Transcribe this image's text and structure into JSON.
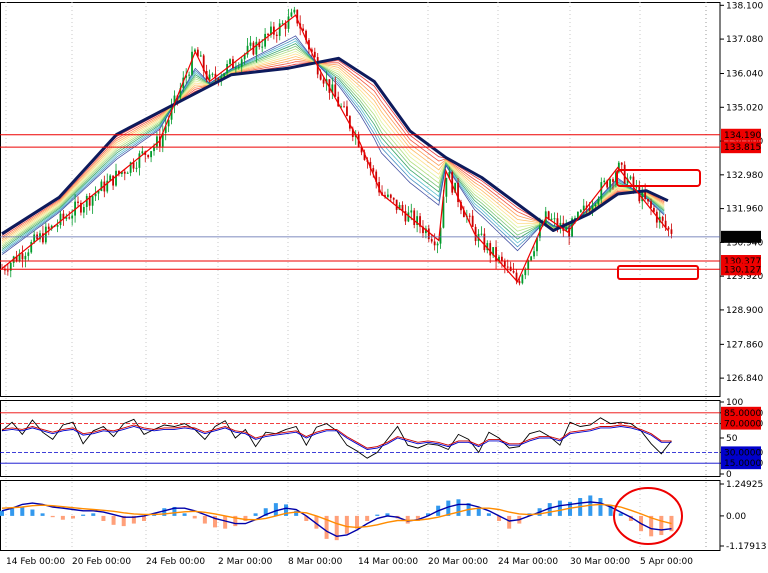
{
  "chart_data": [
    {
      "type": "candlestick",
      "panel": "price",
      "yticks": [
        "138.100",
        "137.080",
        "136.040",
        "135.020",
        "134.000",
        "132.980",
        "131.960",
        "130.940",
        "129.920",
        "128.900",
        "127.860",
        "126.840"
      ],
      "ylim": [
        126.3,
        138.2
      ],
      "xticks": [
        "14 Feb 00:00",
        "20 Feb 00:00",
        "24 Feb 00:00",
        "2 Mar 00:00",
        "8 Mar 00:00",
        "14 Mar 00:00",
        "20 Mar 00:00",
        "24 Mar 00:00",
        "30 Mar 00:00",
        "5 Apr 00:00"
      ],
      "hlines": [
        {
          "label": "134.190",
          "value": 134.19,
          "color": "#ee0000"
        },
        {
          "label": "133.815",
          "value": 133.815,
          "color": "#ee0000"
        },
        {
          "label": "130.377",
          "value": 130.377,
          "color": "#ee0000"
        },
        {
          "label": "130.127",
          "value": 130.127,
          "color": "#ee0000"
        }
      ],
      "current_price": {
        "label": "131.107",
        "value": 131.107,
        "color": "#000000"
      },
      "zigzag": [
        {
          "x": 0.0,
          "y": 130.15
        },
        {
          "x": 0.22,
          "y": 134.0
        },
        {
          "x": 0.27,
          "y": 136.7
        },
        {
          "x": 0.29,
          "y": 135.8
        },
        {
          "x": 0.41,
          "y": 137.8
        },
        {
          "x": 0.44,
          "y": 136.3
        },
        {
          "x": 0.5,
          "y": 133.95
        },
        {
          "x": 0.53,
          "y": 132.4
        },
        {
          "x": 0.61,
          "y": 131.0
        },
        {
          "x": 0.62,
          "y": 133.1
        },
        {
          "x": 0.66,
          "y": 131.2
        },
        {
          "x": 0.72,
          "y": 129.75
        },
        {
          "x": 0.76,
          "y": 131.7
        },
        {
          "x": 0.79,
          "y": 131.25
        },
        {
          "x": 0.86,
          "y": 133.2
        },
        {
          "x": 0.93,
          "y": 131.3
        }
      ],
      "ma_main": [
        {
          "x": 0.0,
          "y": 131.2
        },
        {
          "x": 0.08,
          "y": 132.3
        },
        {
          "x": 0.16,
          "y": 134.2
        },
        {
          "x": 0.24,
          "y": 135.1
        },
        {
          "x": 0.32,
          "y": 136.0
        },
        {
          "x": 0.4,
          "y": 136.2
        },
        {
          "x": 0.47,
          "y": 136.5
        },
        {
          "x": 0.52,
          "y": 135.8
        },
        {
          "x": 0.57,
          "y": 134.3
        },
        {
          "x": 0.62,
          "y": 133.5
        },
        {
          "x": 0.67,
          "y": 132.9
        },
        {
          "x": 0.72,
          "y": 132.1
        },
        {
          "x": 0.77,
          "y": 131.3
        },
        {
          "x": 0.82,
          "y": 131.8
        },
        {
          "x": 0.86,
          "y": 132.4
        },
        {
          "x": 0.9,
          "y": 132.5
        },
        {
          "x": 0.93,
          "y": 132.2
        }
      ]
    },
    {
      "type": "line",
      "panel": "oscillator",
      "yticks": [
        "100",
        "85.0000",
        "70.0000",
        "50",
        "30.0000",
        "15.0000",
        "0"
      ],
      "ylim": [
        0,
        100
      ],
      "levels": [
        {
          "label": "85.0000",
          "value": 85,
          "color": "#ee0000"
        },
        {
          "label": "70.0000",
          "value": 70,
          "color": "#ee0000"
        },
        {
          "label": "30.0000",
          "value": 30,
          "color": "#0000cc"
        },
        {
          "label": "15.0000",
          "value": 15,
          "color": "#0000cc"
        }
      ],
      "series": [
        {
          "color": "#000000",
          "values": [
            60,
            72,
            55,
            75,
            58,
            48,
            68,
            72,
            42,
            60,
            66,
            52,
            70,
            76,
            55,
            62,
            68,
            66,
            70,
            62,
            48,
            66,
            74,
            50,
            62,
            38,
            58,
            56,
            62,
            66,
            40,
            65,
            70,
            60,
            40,
            32,
            22,
            30,
            48,
            66,
            40,
            36,
            42,
            40,
            34,
            55,
            48,
            30,
            58,
            50,
            36,
            38,
            56,
            60,
            52,
            40,
            72,
            66,
            68,
            78,
            70,
            72,
            70,
            60,
            42,
            28,
            46
          ]
        },
        {
          "color": "#cc0000",
          "values": [
            62,
            64,
            62,
            66,
            62,
            58,
            62,
            64,
            56,
            58,
            62,
            60,
            64,
            68,
            64,
            62,
            64,
            64,
            66,
            64,
            58,
            62,
            66,
            60,
            58,
            50,
            54,
            56,
            58,
            60,
            52,
            58,
            62,
            62,
            52,
            44,
            36,
            38,
            44,
            52,
            48,
            44,
            46,
            44,
            40,
            46,
            46,
            40,
            48,
            48,
            42,
            42,
            48,
            52,
            52,
            48,
            58,
            60,
            62,
            66,
            66,
            68,
            66,
            62,
            56,
            46,
            46
          ]
        },
        {
          "color": "#0000cc",
          "values": [
            60,
            62,
            60,
            64,
            60,
            56,
            60,
            62,
            54,
            56,
            60,
            58,
            62,
            66,
            62,
            60,
            62,
            62,
            64,
            62,
            56,
            60,
            64,
            58,
            56,
            48,
            52,
            54,
            56,
            58,
            50,
            56,
            60,
            60,
            50,
            42,
            34,
            36,
            42,
            50,
            46,
            42,
            44,
            42,
            38,
            44,
            44,
            38,
            46,
            46,
            40,
            40,
            46,
            50,
            50,
            46,
            56,
            58,
            60,
            64,
            64,
            66,
            64,
            60,
            54,
            44,
            44
          ]
        }
      ]
    },
    {
      "type": "bar",
      "panel": "macd",
      "yticks": [
        "1.24925",
        "0.00",
        "-1.17913"
      ],
      "ylim": [
        -1.17913,
        1.24925
      ],
      "bars": [
        0.2,
        0.3,
        0.35,
        0.25,
        0.1,
        -0.05,
        -0.15,
        -0.1,
        0.05,
        0.1,
        -0.2,
        -0.35,
        -0.4,
        -0.3,
        -0.2,
        0.1,
        0.3,
        0.35,
        0.1,
        -0.1,
        -0.3,
        -0.45,
        -0.5,
        -0.4,
        -0.2,
        0.1,
        0.3,
        0.5,
        0.45,
        0.2,
        -0.2,
        -0.5,
        -0.9,
        -0.95,
        -0.7,
        -0.5,
        -0.2,
        0.05,
        0.1,
        -0.1,
        -0.3,
        -0.2,
        0.1,
        0.4,
        0.6,
        0.65,
        0.5,
        0.3,
        0.1,
        -0.2,
        -0.5,
        -0.3,
        0.1,
        0.3,
        0.5,
        0.6,
        0.55,
        0.7,
        0.8,
        0.7,
        0.4,
        0.1,
        -0.2,
        -0.6,
        -0.8,
        -0.75,
        -0.6
      ],
      "macd_line": [
        0.2,
        0.3,
        0.45,
        0.5,
        0.45,
        0.35,
        0.3,
        0.25,
        0.2,
        0.2,
        0.15,
        0.05,
        -0.05,
        -0.05,
        0.0,
        0.1,
        0.2,
        0.3,
        0.3,
        0.2,
        0.05,
        -0.1,
        -0.2,
        -0.3,
        -0.3,
        -0.15,
        0.05,
        0.2,
        0.3,
        0.25,
        0.0,
        -0.3,
        -0.6,
        -0.8,
        -0.75,
        -0.55,
        -0.3,
        -0.1,
        0.0,
        -0.05,
        -0.2,
        -0.15,
        0.0,
        0.2,
        0.35,
        0.45,
        0.45,
        0.35,
        0.2,
        0.0,
        -0.2,
        -0.15,
        0.0,
        0.15,
        0.3,
        0.4,
        0.45,
        0.5,
        0.55,
        0.5,
        0.35,
        0.15,
        -0.05,
        -0.3,
        -0.5,
        -0.55,
        -0.5
      ],
      "signal_line": [
        0.3,
        0.32,
        0.35,
        0.4,
        0.42,
        0.4,
        0.36,
        0.32,
        0.28,
        0.25,
        0.22,
        0.18,
        0.12,
        0.08,
        0.06,
        0.06,
        0.08,
        0.12,
        0.16,
        0.18,
        0.14,
        0.08,
        0.0,
        -0.08,
        -0.14,
        -0.15,
        -0.1,
        0.0,
        0.1,
        0.15,
        0.12,
        0.0,
        -0.15,
        -0.3,
        -0.42,
        -0.45,
        -0.42,
        -0.35,
        -0.25,
        -0.18,
        -0.18,
        -0.17,
        -0.12,
        -0.05,
        0.05,
        0.15,
        0.25,
        0.3,
        0.3,
        0.25,
        0.15,
        0.08,
        0.05,
        0.08,
        0.15,
        0.22,
        0.3,
        0.36,
        0.42,
        0.45,
        0.42,
        0.35,
        0.22,
        0.08,
        -0.08,
        -0.2,
        -0.3
      ]
    }
  ],
  "colors": {
    "border": "#000000",
    "grid": "#c8c8c8",
    "bull": "#009a2a",
    "bear": "#cc0000",
    "ma_main": "#0d1a5c",
    "zigzag": "#ee0000",
    "hist_pos": "#3399ee",
    "hist_neg": "#ffa07a",
    "macd_line": "#0000aa",
    "signal_line": "#ff8c00",
    "annotation": "#ee0000"
  }
}
